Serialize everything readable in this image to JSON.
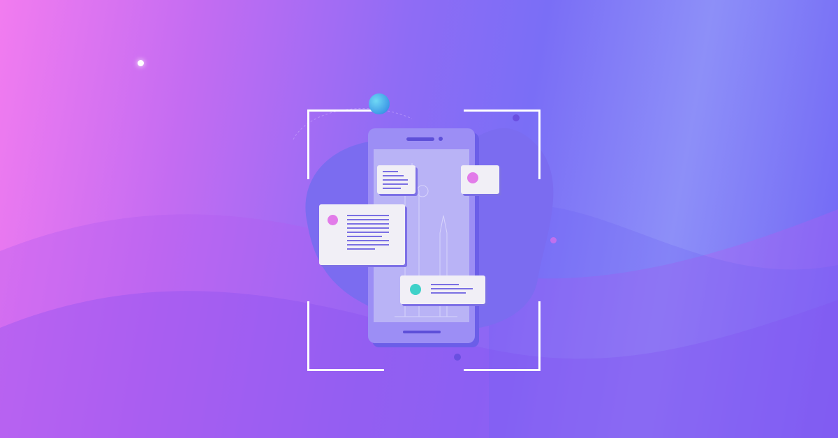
{
  "colors": {
    "background_left": "#f27cf0",
    "background_mid": "#8f6cf5",
    "background_right": "#6f63f5",
    "blob": "#7b6cf0",
    "phone": "#9c8ef5",
    "card": "#f1eff6",
    "accent_pink": "#e27be9",
    "accent_teal": "#3fd1c9"
  },
  "illustration": {
    "icons": [
      "smartphone-icon",
      "checkmark-icon",
      "user-avatar-icon",
      "scan-frame-icon"
    ]
  }
}
